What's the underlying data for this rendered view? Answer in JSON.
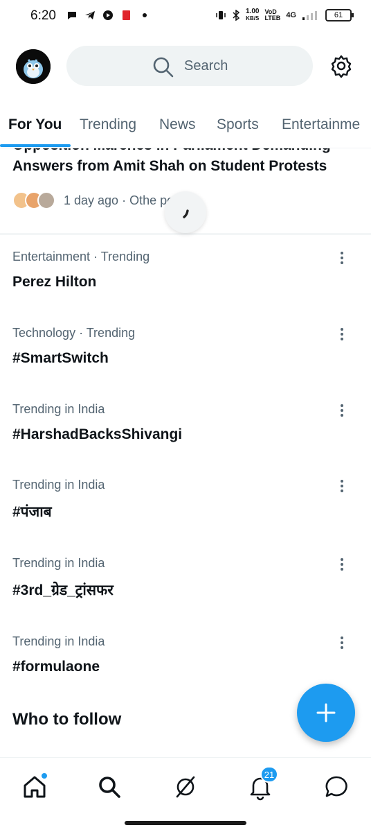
{
  "status_bar": {
    "time": "6:20",
    "speed_value": "1.00",
    "speed_unit": "KB/S",
    "carrier_top": "VoD",
    "carrier_bottom": "LTEB",
    "network": "4G",
    "battery": "61"
  },
  "header": {
    "search_placeholder": "Search"
  },
  "tabs": [
    {
      "label": "For You",
      "active": true
    },
    {
      "label": "Trending"
    },
    {
      "label": "News"
    },
    {
      "label": "Sports"
    },
    {
      "label": "Entertainme"
    }
  ],
  "news": {
    "cut_title": "Opposition Marches in Parliament Demanding",
    "title": "Answers from Amit Shah on Student Protests",
    "meta": "1 day ago · Othe     posts"
  },
  "trends": [
    {
      "meta": "Entertainment · Trending",
      "name": "Perez Hilton"
    },
    {
      "meta": "Technology · Trending",
      "name": "#SmartSwitch"
    },
    {
      "meta": "Trending in India",
      "name": "#HarshadBacksShivangi"
    },
    {
      "meta": "Trending in India",
      "name": "#पंजाब"
    },
    {
      "meta": "Trending in India",
      "name": "#3rd_ग्रेड_ट्रांसफर"
    },
    {
      "meta": "Trending in India",
      "name": "#formulaone"
    }
  ],
  "who_to_follow": "Who to follow",
  "notifications_badge": "21",
  "colors": {
    "accent": "#1d9bf0",
    "text": "#0f1419",
    "muted": "#536471"
  }
}
